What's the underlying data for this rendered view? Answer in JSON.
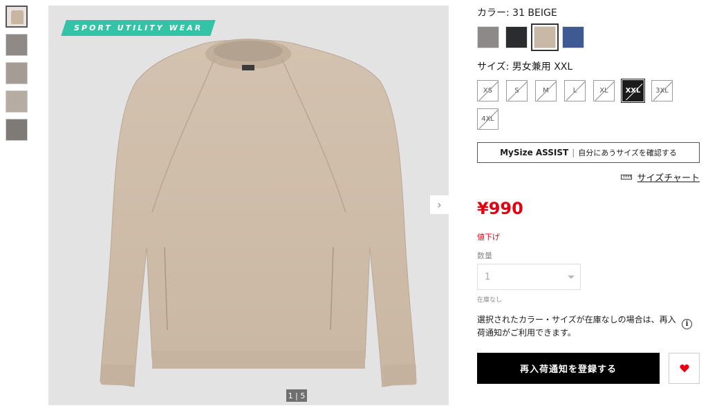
{
  "gallery": {
    "tag_text": "SPORT UTILITY WEAR",
    "counter": "1 | 5",
    "next_icon": "chevron-right-icon",
    "thumbnail_count": 5
  },
  "color": {
    "label": "カラー: 31 BEIGE",
    "swatches": [
      {
        "name": "gray",
        "hex": "#8c8a88"
      },
      {
        "name": "black",
        "hex": "#2b2c2e"
      },
      {
        "name": "beige",
        "hex": "#c9b8a5",
        "selected": true
      },
      {
        "name": "blue",
        "hex": "#3f5a92"
      }
    ]
  },
  "size": {
    "label": "サイズ: 男女兼用 XXL",
    "options": [
      "XS",
      "S",
      "M",
      "L",
      "XL",
      "XXL",
      "3XL",
      "4XL"
    ],
    "selected": "XXL"
  },
  "mysize": {
    "brand": "MySize ASSIST",
    "separator": "|",
    "text": "自分にあうサイズを確認する"
  },
  "size_chart": {
    "label": "サイズチャート",
    "icon": "ruler-icon"
  },
  "price": "¥990",
  "discount_label": "値下げ",
  "quantity": {
    "label": "数量",
    "value": "1"
  },
  "stock_status": "在庫なし",
  "restock_notice": "選択されたカラー・サイズが在庫なしの場合は、再入荷通知がご利用できます。",
  "info_icon_glyph": "i",
  "restock_button": "再入荷通知を登録する",
  "colors": {
    "price_red": "#e60012",
    "tag_green": "#33c3a7",
    "button_black": "#000000"
  }
}
